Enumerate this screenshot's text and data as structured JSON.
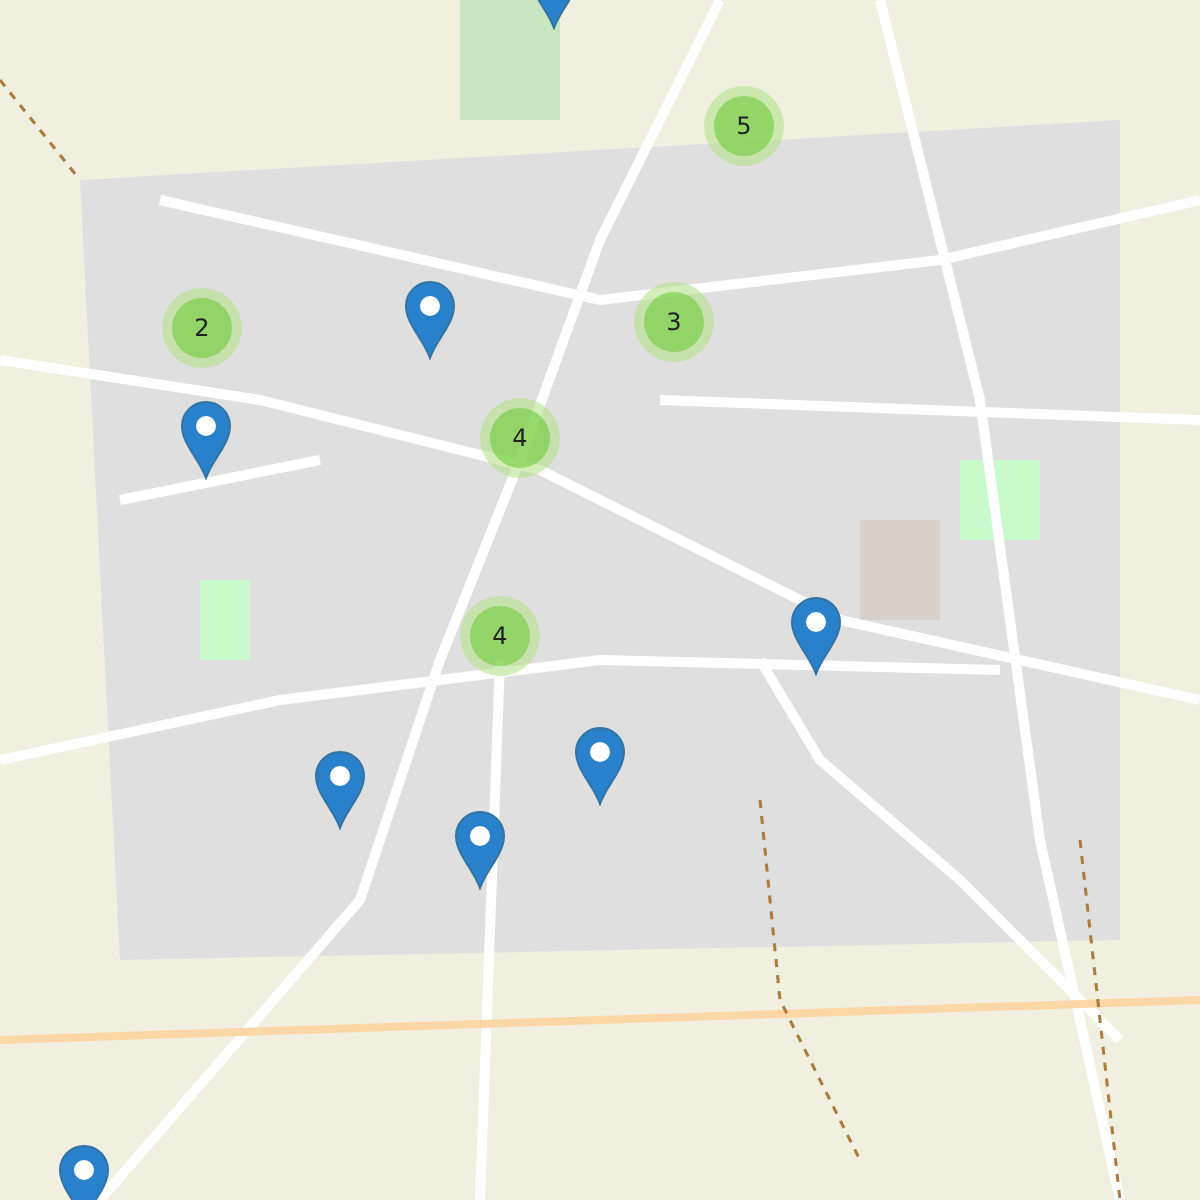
{
  "map": {
    "markers": [
      {
        "kind": "cluster",
        "count": "5"
      },
      {
        "kind": "cluster",
        "count": "2"
      },
      {
        "kind": "cluster",
        "count": "3"
      },
      {
        "kind": "cluster",
        "count": "4"
      },
      {
        "kind": "cluster",
        "count": "4"
      },
      {
        "kind": "pin"
      },
      {
        "kind": "pin"
      },
      {
        "kind": "pin"
      },
      {
        "kind": "pin"
      },
      {
        "kind": "pin"
      },
      {
        "kind": "pin"
      },
      {
        "kind": "pin"
      },
      {
        "kind": "pin"
      }
    ]
  }
}
